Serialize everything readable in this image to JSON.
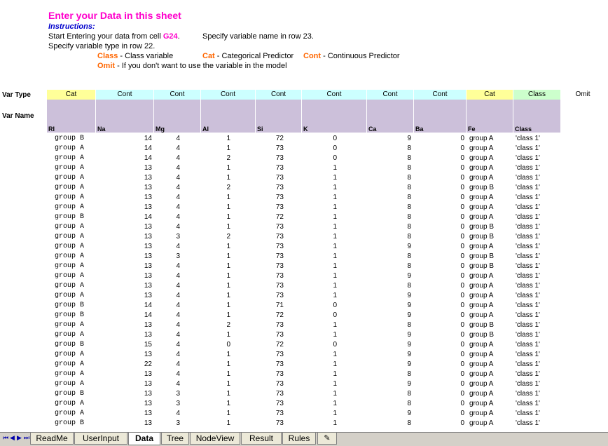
{
  "header": {
    "title": "Enter your Data in this sheet",
    "instructions_label": "Instructions:",
    "line1_prefix": "Start Entering your data from cell ",
    "line1_cell": "G24",
    "line1_suffix": ".",
    "line1_right": "Specify variable name in row 23.",
    "line2": "Specify variable type in row 22."
  },
  "legend": {
    "class_key": "Class",
    "class_desc": " - Class variable",
    "cat_key": "Cat",
    "cat_desc": " - Categorical Predictor",
    "cont_key": "Cont",
    "cont_desc": " - Continuous Predictor",
    "omit_key": "Omit",
    "omit_desc": " - If you don't want to use the variable in the model"
  },
  "row_labels": {
    "var_type": "Var Type",
    "var_name": "Var Name"
  },
  "var_types": [
    "Cat",
    "Cont",
    "Cont",
    "Cont",
    "Cont",
    "Cont",
    "Cont",
    "Cont",
    "Cat",
    "Class",
    "Omit"
  ],
  "var_names": [
    "RI",
    "Na",
    "Mg",
    "Al",
    "Si",
    "K",
    "Ca",
    "Ba",
    "Fe",
    "Class"
  ],
  "rows": [
    [
      "group B",
      "14",
      "4",
      "1",
      "72",
      "0",
      "9",
      "0",
      "group A",
      "'class 1'"
    ],
    [
      "group A",
      "14",
      "4",
      "1",
      "73",
      "0",
      "8",
      "0",
      "group A",
      "'class 1'"
    ],
    [
      "group A",
      "14",
      "4",
      "2",
      "73",
      "0",
      "8",
      "0",
      "group A",
      "'class 1'"
    ],
    [
      "group A",
      "13",
      "4",
      "1",
      "73",
      "1",
      "8",
      "0",
      "group A",
      "'class 1'"
    ],
    [
      "group A",
      "13",
      "4",
      "1",
      "73",
      "1",
      "8",
      "0",
      "group A",
      "'class 1'"
    ],
    [
      "group A",
      "13",
      "4",
      "2",
      "73",
      "1",
      "8",
      "0",
      "group B",
      "'class 1'"
    ],
    [
      "group A",
      "13",
      "4",
      "1",
      "73",
      "1",
      "8",
      "0",
      "group A",
      "'class 1'"
    ],
    [
      "group A",
      "13",
      "4",
      "1",
      "73",
      "1",
      "8",
      "0",
      "group A",
      "'class 1'"
    ],
    [
      "group B",
      "14",
      "4",
      "1",
      "72",
      "1",
      "8",
      "0",
      "group A",
      "'class 1'"
    ],
    [
      "group A",
      "13",
      "4",
      "1",
      "73",
      "1",
      "8",
      "0",
      "group B",
      "'class 1'"
    ],
    [
      "group A",
      "13",
      "3",
      "2",
      "73",
      "1",
      "8",
      "0",
      "group B",
      "'class 1'"
    ],
    [
      "group A",
      "13",
      "4",
      "1",
      "73",
      "1",
      "9",
      "0",
      "group A",
      "'class 1'"
    ],
    [
      "group A",
      "13",
      "3",
      "1",
      "73",
      "1",
      "8",
      "0",
      "group B",
      "'class 1'"
    ],
    [
      "group A",
      "13",
      "4",
      "1",
      "73",
      "1",
      "8",
      "0",
      "group B",
      "'class 1'"
    ],
    [
      "group A",
      "13",
      "4",
      "1",
      "73",
      "1",
      "9",
      "0",
      "group A",
      "'class 1'"
    ],
    [
      "group A",
      "13",
      "4",
      "1",
      "73",
      "1",
      "8",
      "0",
      "group A",
      "'class 1'"
    ],
    [
      "group A",
      "13",
      "4",
      "1",
      "73",
      "1",
      "9",
      "0",
      "group A",
      "'class 1'"
    ],
    [
      "group B",
      "14",
      "4",
      "1",
      "71",
      "0",
      "9",
      "0",
      "group A",
      "'class 1'"
    ],
    [
      "group B",
      "14",
      "4",
      "1",
      "72",
      "0",
      "9",
      "0",
      "group A",
      "'class 1'"
    ],
    [
      "group A",
      "13",
      "4",
      "2",
      "73",
      "1",
      "8",
      "0",
      "group B",
      "'class 1'"
    ],
    [
      "group A",
      "13",
      "4",
      "1",
      "73",
      "1",
      "9",
      "0",
      "group B",
      "'class 1'"
    ],
    [
      "group B",
      "15",
      "4",
      "0",
      "72",
      "0",
      "9",
      "0",
      "group A",
      "'class 1'"
    ],
    [
      "group A",
      "13",
      "4",
      "1",
      "73",
      "1",
      "9",
      "0",
      "group A",
      "'class 1'"
    ],
    [
      "group A",
      "22",
      "4",
      "1",
      "73",
      "1",
      "9",
      "0",
      "group A",
      "'class 1'"
    ],
    [
      "group A",
      "13",
      "4",
      "1",
      "73",
      "1",
      "8",
      "0",
      "group A",
      "'class 1'"
    ],
    [
      "group A",
      "13",
      "4",
      "1",
      "73",
      "1",
      "9",
      "0",
      "group A",
      "'class 1'"
    ],
    [
      "group B",
      "13",
      "3",
      "1",
      "73",
      "1",
      "8",
      "0",
      "group A",
      "'class 1'"
    ],
    [
      "group A",
      "13",
      "3",
      "1",
      "73",
      "1",
      "8",
      "0",
      "group A",
      "'class 1'"
    ],
    [
      "group A",
      "13",
      "4",
      "1",
      "73",
      "1",
      "9",
      "0",
      "group A",
      "'class 1'"
    ],
    [
      "group B",
      "13",
      "3",
      "1",
      "73",
      "1",
      "8",
      "0",
      "group A",
      "'class 1'"
    ]
  ],
  "tabs": [
    {
      "label": "ReadMe",
      "active": false
    },
    {
      "label": "UserInput",
      "active": false
    },
    {
      "label": "Data",
      "active": true
    },
    {
      "label": "Tree",
      "active": false
    },
    {
      "label": "NodeView",
      "active": false
    },
    {
      "label": "Result",
      "active": false
    },
    {
      "label": "Rules",
      "active": false
    }
  ],
  "nav_buttons": [
    "⏮",
    "◀",
    "▶",
    "⏭"
  ]
}
